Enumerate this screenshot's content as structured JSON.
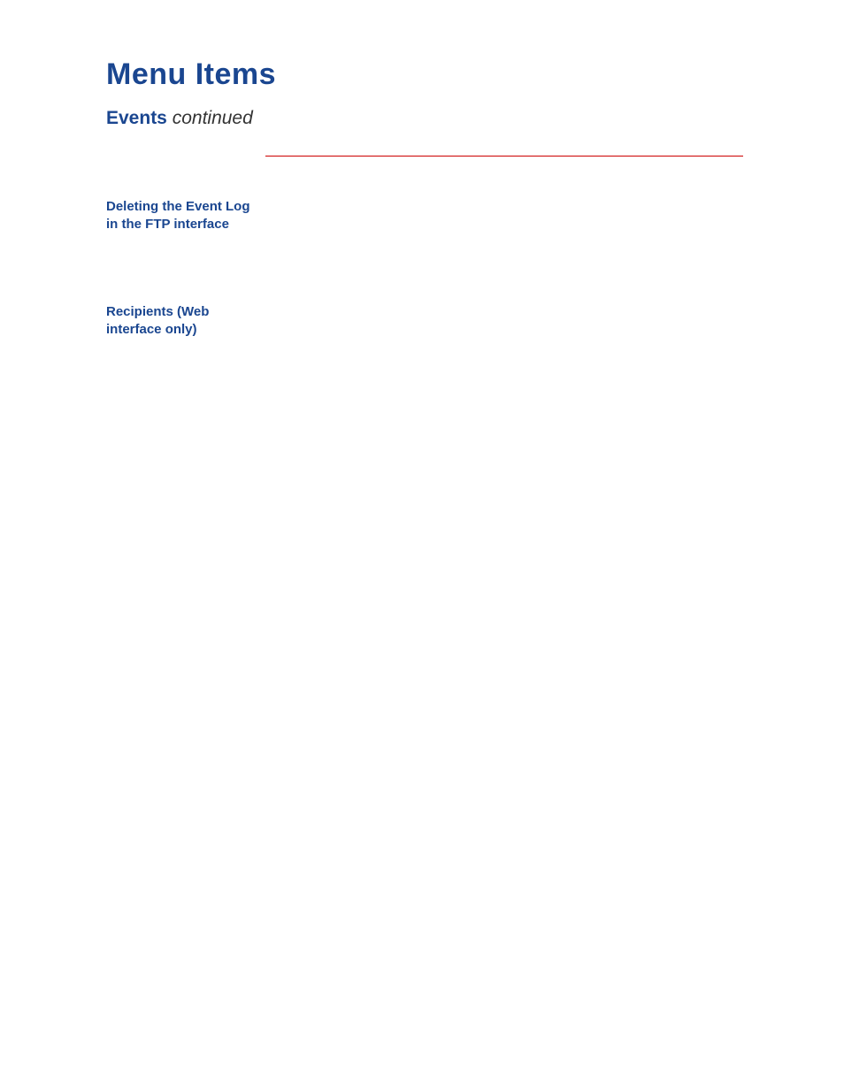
{
  "header": {
    "title": "Menu Items",
    "section": "Events",
    "status": "continued"
  },
  "sidebar": {
    "items": [
      {
        "label": "Deleting the Event Log in the FTP interface"
      },
      {
        "label": "Recipients (Web interface only)"
      }
    ]
  }
}
